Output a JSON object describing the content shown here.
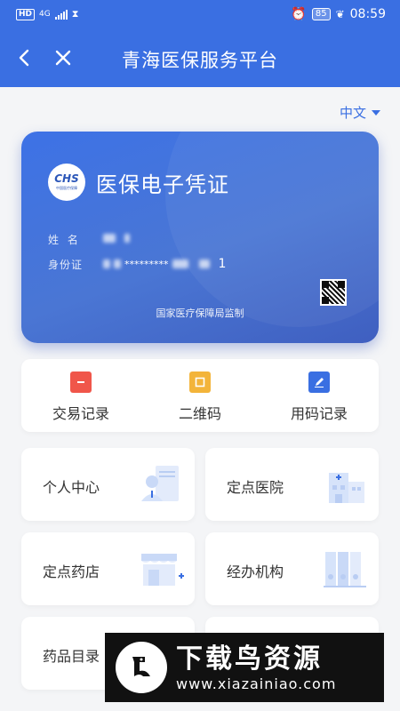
{
  "status_bar": {
    "left_badge": "HD",
    "network": "4G",
    "battery": "85",
    "time": "08:59"
  },
  "header": {
    "title": "青海医保服务平台",
    "back_icon": "chevron-left-icon",
    "close_icon": "close-icon"
  },
  "language": {
    "selected": "中文"
  },
  "card": {
    "logo_text": "CHS",
    "logo_subtext": "中国医疗保障",
    "title": "医保电子凭证",
    "name_label": "姓 名",
    "id_label": "身份证",
    "id_masked": "*********",
    "id_tail": "1",
    "footer": "国家医疗保障局监制"
  },
  "quick_actions": [
    {
      "label": "交易记录",
      "icon": "transaction-record-icon",
      "color": "#f0564a"
    },
    {
      "label": "二维码",
      "icon": "qr-code-icon",
      "color": "#f3b43a"
    },
    {
      "label": "用码记录",
      "icon": "edit-record-icon",
      "color": "#3a6fe2"
    }
  ],
  "tiles": [
    {
      "label": "个人中心",
      "icon": "personal-center-icon"
    },
    {
      "label": "定点医院",
      "icon": "hospital-icon"
    },
    {
      "label": "定点药店",
      "icon": "pharmacy-icon"
    },
    {
      "label": "经办机构",
      "icon": "agency-binders-icon"
    },
    {
      "label": "药品目录",
      "icon": "drug-catalog-icon"
    }
  ],
  "watermark": {
    "title": "下载鸟资源",
    "url": "www.xiazainiao.com"
  },
  "colors": {
    "primary": "#3a6fe2",
    "background": "#f4f5f7"
  }
}
